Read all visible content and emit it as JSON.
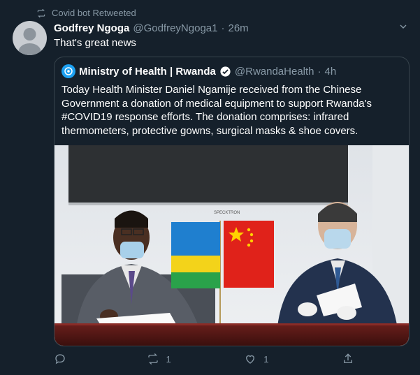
{
  "retweet": {
    "label": "Covid bot Retweeted",
    "icon": "retweet-icon"
  },
  "tweet": {
    "author_name": "Godfrey Ngoga",
    "author_handle": "@GodfreyNgoga1",
    "separator": "·",
    "time": "26m",
    "text": "That's great news"
  },
  "quote": {
    "author_name": "Ministry of Health | Rwanda",
    "author_handle": "@RwandaHealth",
    "separator": "·",
    "time": "4h",
    "verified": true,
    "text": "Today Health Minister Daniel Ngamije received from the Chinese Government a donation of medical equipment to support Rwanda's #COVID19 response efforts. The donation comprises: infrared thermometers, protective gowns, surgical masks & shoe covers."
  },
  "photo_caption_text": "SPECKTRON",
  "actions": {
    "reply_count": "",
    "retweet_count": "1",
    "like_count": "1"
  },
  "colors": {
    "background": "#15202b",
    "muted": "#8899a6",
    "accent": "#1da1f2",
    "border": "#38444d"
  }
}
